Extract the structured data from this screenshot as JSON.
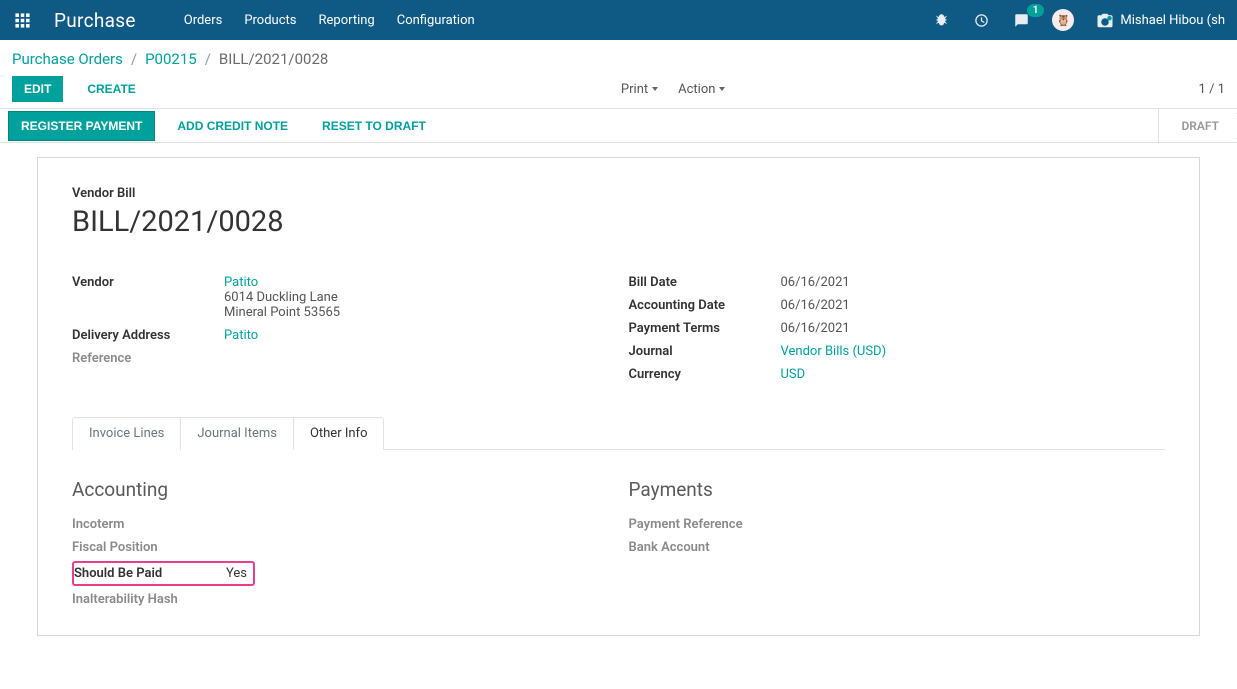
{
  "header": {
    "app_title": "Purchase",
    "menu": [
      "Orders",
      "Products",
      "Reporting",
      "Configuration"
    ],
    "msg_count": "1",
    "user_name": "Mishael Hibou (sh"
  },
  "breadcrumb": {
    "items": [
      "Purchase Orders",
      "P00215",
      "BILL/2021/0028"
    ]
  },
  "toolbar": {
    "edit": "Edit",
    "create": "Create",
    "print": "Print",
    "action": "Action",
    "pager": "1 / 1"
  },
  "statusbar": {
    "register_payment": "Register Payment",
    "add_credit_note": "Add Credit Note",
    "reset_draft": "Reset to Draft",
    "stage_draft": "Draft"
  },
  "doc": {
    "type_label": "Vendor Bill",
    "title": "BILL/2021/0028"
  },
  "left_fields": {
    "vendor_label": "Vendor",
    "vendor_name": "Patito",
    "vendor_addr1": "6014 Duckling Lane",
    "vendor_addr2": "Mineral Point 53565",
    "delivery_label": "Delivery Address",
    "delivery_value": "Patito",
    "reference_label": "Reference"
  },
  "right_fields": {
    "bill_date_label": "Bill Date",
    "bill_date": "06/16/2021",
    "acct_date_label": "Accounting Date",
    "acct_date": "06/16/2021",
    "pay_terms_label": "Payment Terms",
    "pay_terms": "06/16/2021",
    "journal_label": "Journal",
    "journal": "Vendor Bills (USD)",
    "currency_label": "Currency",
    "currency": "USD"
  },
  "tabs": [
    "Invoice Lines",
    "Journal Items",
    "Other Info"
  ],
  "other_info": {
    "accounting_title": "Accounting",
    "incoterm_label": "Incoterm",
    "fiscal_label": "Fiscal Position",
    "should_paid_label": "Should Be Paid",
    "should_paid_value": "Yes",
    "hash_label": "Inalterability Hash",
    "payments_title": "Payments",
    "pay_ref_label": "Payment Reference",
    "bank_label": "Bank Account"
  }
}
